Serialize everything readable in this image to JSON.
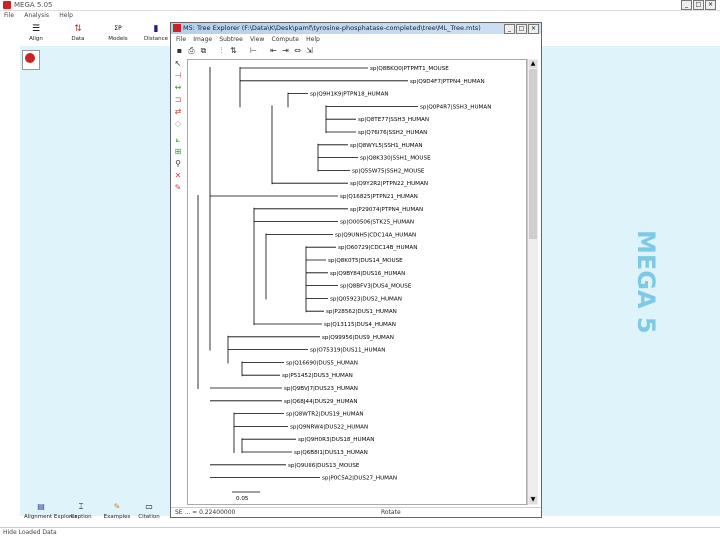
{
  "app": {
    "title": "MEGA 5.05",
    "watermark": "MEGA 5"
  },
  "main_menu": [
    "File",
    "Analysis",
    "Help"
  ],
  "main_toolbar": [
    {
      "label": "Align",
      "icon": "align-icon"
    },
    {
      "label": "Data",
      "icon": "data-icon"
    },
    {
      "label": "Models",
      "icon": "models-icon"
    },
    {
      "label": "Distance",
      "icon": "distance-icon"
    }
  ],
  "bottom_toolbar": [
    {
      "label": "Alignment Explorer",
      "icon": "alignment-explorer-icon"
    },
    {
      "label": "Caption",
      "icon": "caption-icon"
    },
    {
      "label": "Examples",
      "icon": "examples-icon"
    },
    {
      "label": "Citation",
      "icon": "citation-icon"
    }
  ],
  "main_status": "Hide Loaded Data",
  "tree_window": {
    "title": "M5: Tree Explorer (F:\\Data\\K\\Desk\\pamf\\tyrosine-phosphatase-completed\\tree\\ML_Tree.mts)",
    "menu": [
      "File",
      "Image",
      "Subtree",
      "View",
      "Compute",
      "Help"
    ],
    "status_left": "SE ... = 0.22400000",
    "status_right": "Rotate"
  },
  "tree": {
    "scale_label": "0.05",
    "taxa": [
      "sp|Q8BKQ0|PTPMT1_MOUSE",
      "sp|Q9D4F7|PTPN4_HUMAN",
      "sp|Q9H1K9|PTPN18_HUMAN",
      "sp|Q0P4R7|SSH3_HUMAN",
      "sp|Q8TE77|SSH3_HUMAN",
      "sp|Q76I76|SSH2_HUMAN",
      "sp|Q8WYL5|SSH1_HUMAN",
      "sp|Q8K330|SSH1_MOUSE",
      "sp|Q5SW75|SSH2_MOUSE",
      "sp|Q9Y2R2|PTPN22_HUMAN",
      "sp|Q16825|PTPN21_HUMAN",
      "sp|P29074|PTPN4_HUMAN",
      "sp|O00506|STK25_HUMAN",
      "sp|Q9UNH5|CDC14A_HUMAN",
      "sp|O60729|CDC14B_HUMAN",
      "sp|Q8K0T5|DUS14_MOUSE",
      "sp|Q9BY84|DUS16_HUMAN",
      "sp|Q8BFV3|DUS4_MOUSE",
      "sp|Q05923|DUS2_HUMAN",
      "sp|P28562|DUS1_HUMAN",
      "sp|Q13115|DUS4_HUMAN",
      "sp|Q99956|DUS9_HUMAN",
      "sp|O75319|DUS11_HUMAN",
      "sp|Q16690|DUS5_HUMAN",
      "sp|P51452|DUS3_HUMAN",
      "sp|Q9BVJ7|DUS23_HUMAN",
      "sp|Q68J44|DUS29_HUMAN",
      "sp|Q8WTR2|DUS19_HUMAN",
      "sp|Q9NRW4|DUS22_HUMAN",
      "sp|Q9H0R3|DUS18_HUMAN",
      "sp|Q6B8I1|DUS13_HUMAN",
      "sp|Q9UII6|DUS13_MOUSE",
      "sp|P0C5A2|DUS27_HUMAN"
    ]
  }
}
